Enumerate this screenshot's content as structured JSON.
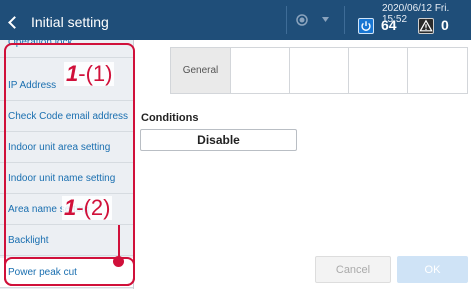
{
  "header": {
    "title": "Initial setting",
    "datetime": "2020/06/12 Fri. 15:52",
    "power_count": "64",
    "alert_count": "0"
  },
  "sidebar": {
    "items": [
      {
        "label": "Operation lock"
      },
      {
        "label": "IP Address"
      },
      {
        "label": "Check Code email address"
      },
      {
        "label": "Indoor unit area setting"
      },
      {
        "label": "Indoor unit name setting"
      },
      {
        "label": "Area name setting"
      },
      {
        "label": "Backlight"
      },
      {
        "label": "Power peak cut"
      }
    ]
  },
  "tabs": [
    {
      "label": "General"
    },
    {
      "label": ""
    },
    {
      "label": ""
    },
    {
      "label": ""
    },
    {
      "label": ""
    }
  ],
  "main": {
    "conditions_label": "Conditions",
    "conditions_value": "Disable"
  },
  "footer": {
    "cancel_label": "Cancel",
    "ok_label": "OK"
  },
  "callouts": {
    "one": {
      "num": "1",
      "sub": "-(1)"
    },
    "two": {
      "num": "1",
      "sub": "-(2)"
    }
  },
  "colors": {
    "header_bg": "#1f4e79",
    "accent_link": "#1a6fb0",
    "callout": "#d0103a"
  }
}
